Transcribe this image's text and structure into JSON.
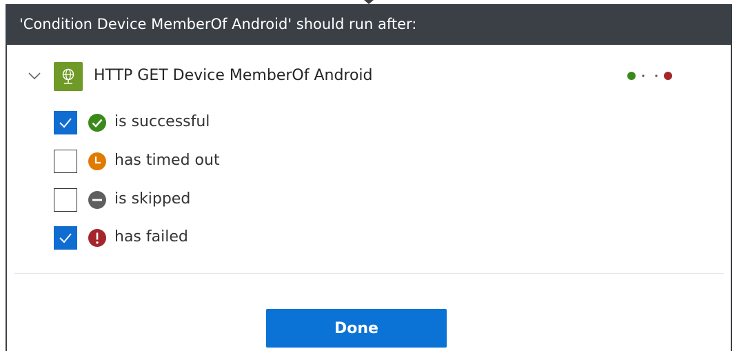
{
  "dialog": {
    "title": "'Condition Device MemberOf Android' should run after:"
  },
  "action": {
    "name": "HTTP GET Device MemberOf Android",
    "icon": "http-globe-icon",
    "icon_color": "#6f9a27",
    "expanded": true,
    "status_colors": [
      "#3a8a1a",
      "#a4262c"
    ]
  },
  "options": [
    {
      "label": "is successful",
      "checked": true,
      "icon": "check-circle-icon",
      "color": "#3a8a1a"
    },
    {
      "label": "has timed out",
      "checked": false,
      "icon": "clock-icon",
      "color": "#e07b00"
    },
    {
      "label": "is skipped",
      "checked": false,
      "icon": "minus-circle-icon",
      "color": "#5f5f5f"
    },
    {
      "label": "has failed",
      "checked": true,
      "icon": "exclamation-circle-icon",
      "color": "#a4262c"
    }
  ],
  "footer": {
    "done_label": "Done",
    "accent_color": "#0c73d6"
  }
}
